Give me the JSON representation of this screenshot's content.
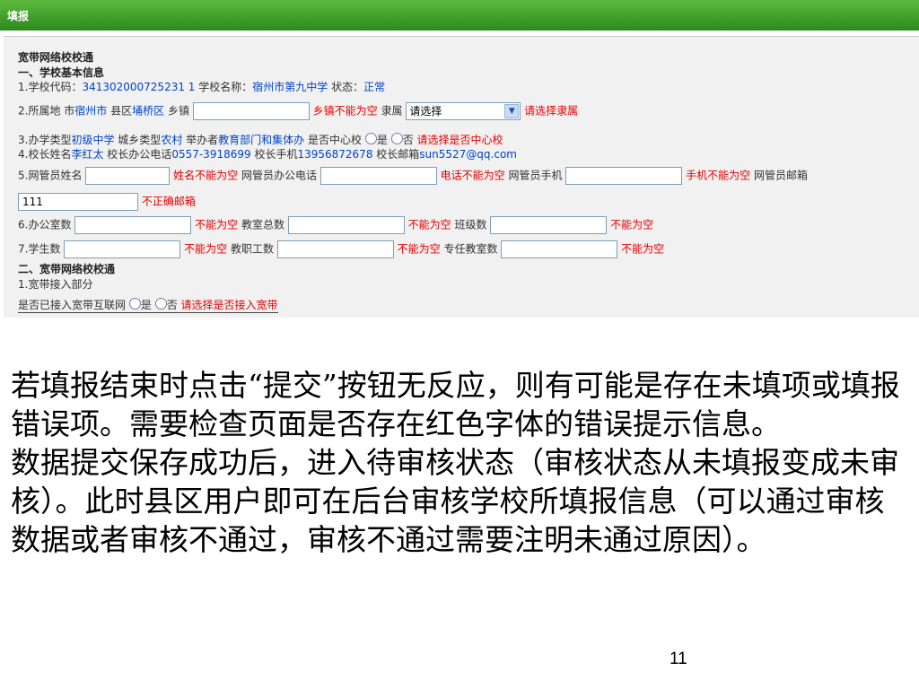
{
  "window": {
    "title": "填报"
  },
  "form": {
    "title": "宽带网络校校通",
    "s1": "一、学校基本信息",
    "r1": {
      "code_label": "1.学校代码：",
      "code": "341302000725231 1",
      "name_label": "学校名称：",
      "name": "宿州市第九中学",
      "status_label": "状态：",
      "status": "正常"
    },
    "r2": {
      "label": "2.所属地 市",
      "city": "宿州市",
      "county_label": "县区",
      "county": "埇桥区",
      "town_label": "乡镇",
      "town_value": "",
      "town_err": "乡镇不能为空",
      "aff_label": "隶属",
      "aff_value": "请选择",
      "aff_err": "请选择隶属"
    },
    "r3": {
      "type_label": "3.办学类型",
      "type": "初级中学",
      "urban_label": "城乡类型",
      "urban": "农村",
      "org_label": "举办者",
      "org": "教育部门和集体办",
      "center_label": "是否中心校",
      "yes": "是",
      "no": "否",
      "err": "请选择是否中心校"
    },
    "r4": {
      "head_label": "4.校长姓名",
      "head": "李红太",
      "office_label": "校长办公电话",
      "office": "0557-3918699",
      "mobile_label": "校长手机",
      "mobile": "13956872678",
      "email_label": "校长邮箱",
      "email": "sun5527@qq.com"
    },
    "r5": {
      "name_label": "5.网管员姓名",
      "name_err": "姓名不能为空",
      "tel_label": "网管员办公电话",
      "tel_err": "电话不能为空",
      "mob_label": "网管员手机",
      "mob_err": "手机不能为空",
      "email_label": "网管员邮箱"
    },
    "r5b": {
      "email_value": "111",
      "email_err": "不正确邮箱"
    },
    "r6": {
      "office_label": "6.办公室数",
      "err": "不能为空",
      "class_label": "教室总数",
      "grade_label": "班级数"
    },
    "r7": {
      "stu_label": "7.学生数",
      "err": "不能为空",
      "staff_label": "教职工数",
      "room_label": "专任教室数"
    },
    "s2": "二、宽带网络校校通",
    "s2_1": "1.宽带接入部分",
    "net": {
      "label": "是否已接入宽带互联网",
      "yes": "是",
      "no": "否",
      "err": "请选择是否接入宽带"
    }
  },
  "caption": {
    "p1": "若填报结束时点击“提交”按钮无反应，则有可能是存在未填项或填报错误项。需要检查页面是否存在红色字体的错误提示信息。",
    "p2": "数据提交保存成功后，进入待审核状态（审核状态从未填报变成未审核）。此时县区用户即可在后台审核学校所填报信息（可以通过审核数据或者审核不通过，审核不通过需要注明未通过原因）。"
  },
  "page_number": "11",
  "colors": {
    "header_green": "#3a9a26",
    "error_red": "#e60000",
    "link_blue": "#0044cc",
    "panel_bg": "#f1f1f1"
  }
}
